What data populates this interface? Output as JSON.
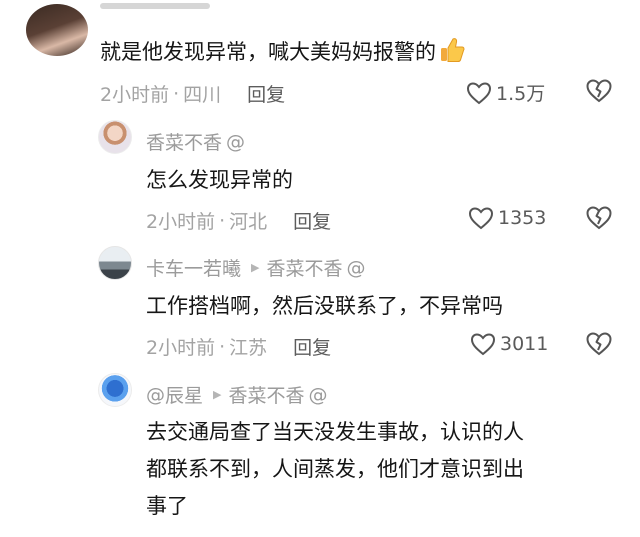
{
  "comments": [
    {
      "username": "",
      "text": "就是他发现异常，喊大美妈妈报警的",
      "emoji": "👍",
      "time": "2小时前",
      "location": "四川",
      "reply_label": "回复",
      "likes": "1.5万"
    },
    {
      "username": "香菜不香",
      "reply_to": "",
      "text": "怎么发现异常的",
      "time": "2小时前",
      "location": "河北",
      "reply_label": "回复",
      "likes": "1353"
    },
    {
      "username": "卡车一若曦",
      "reply_to": "香菜不香",
      "text": "工作搭档啊，然后没联系了，不异常吗",
      "time": "2小时前",
      "location": "江苏",
      "reply_label": "回复",
      "likes": "3011"
    },
    {
      "username": "辰星",
      "reply_to": "香菜不香",
      "text_line1": "去交通局查了当天没发生事故，认识的人",
      "text_line2": "都联系不到，人间蒸发，他们才意识到出",
      "text_line3": "事了"
    }
  ],
  "icons": {
    "like": "heart-outline-icon",
    "dislike": "broken-heart-icon",
    "separator": "dot",
    "mention": "@"
  }
}
